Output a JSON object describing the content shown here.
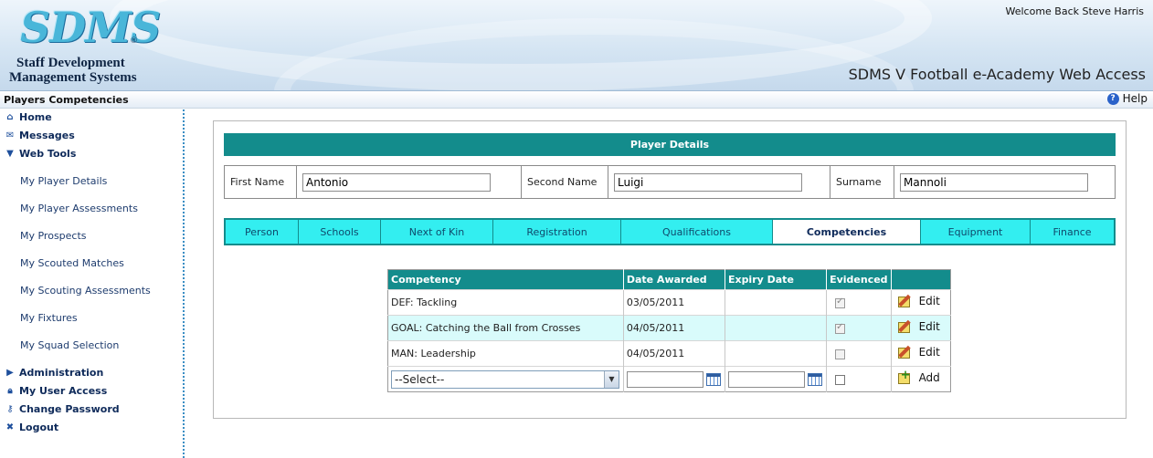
{
  "header": {
    "logo_mark": "SDMS",
    "logo_reg": "®",
    "logo_line1": "Staff Development",
    "logo_line2": "Management Systems",
    "welcome": "Welcome Back Steve Harris",
    "app_title": "SDMS V Football e-Academy Web Access"
  },
  "titlebar": {
    "page_title": "Players Competencies",
    "help_label": "Help"
  },
  "sidebar": {
    "top_items": [
      {
        "label": "Home",
        "icon": "home-icon"
      },
      {
        "label": "Messages",
        "icon": "messages-icon"
      },
      {
        "label": "Web Tools",
        "icon": "triangle-down-icon"
      }
    ],
    "sub_items": [
      "My Player Details",
      "My Player Assessments",
      "My Prospects",
      "My Scouted Matches",
      "My Scouting Assessments",
      "My Fixtures",
      "My Squad Selection"
    ],
    "bottom_items": [
      {
        "label": "Administration",
        "icon": "triangle-right-icon"
      },
      {
        "label": "My User Access",
        "icon": "lock-icon"
      },
      {
        "label": "Change Password",
        "icon": "key-icon"
      },
      {
        "label": "Logout",
        "icon": "close-icon"
      }
    ]
  },
  "player_details": {
    "header": "Player Details",
    "first_name_label": "First Name",
    "first_name_value": "Antonio",
    "second_name_label": "Second Name",
    "second_name_value": "Luigi",
    "surname_label": "Surname",
    "surname_value": "Mannoli"
  },
  "tabs": [
    "Person",
    "Schools",
    "Next of Kin",
    "Registration",
    "Qualifications",
    "Competencies",
    "Equipment",
    "Finance"
  ],
  "active_tab": "Competencies",
  "competencies": {
    "columns": [
      "Competency",
      "Date Awarded",
      "Expiry Date",
      "Evidenced",
      ""
    ],
    "rows": [
      {
        "competency": "DEF: Tackling",
        "date_awarded": "03/05/2011",
        "expiry_date": "",
        "evidenced": true,
        "action": "Edit"
      },
      {
        "competency": "GOAL: Catching the Ball from Crosses",
        "date_awarded": "04/05/2011",
        "expiry_date": "",
        "evidenced": true,
        "action": "Edit"
      },
      {
        "competency": "MAN: Leadership",
        "date_awarded": "04/05/2011",
        "expiry_date": "",
        "evidenced": false,
        "action": "Edit"
      }
    ],
    "new_row": {
      "select_value": "--Select--",
      "action": "Add"
    }
  },
  "colors": {
    "teal": "#138c8c",
    "tab_cyan": "#33eef0",
    "alt_row": "#d9fbfb",
    "nav_text": "#0e2a5a"
  }
}
